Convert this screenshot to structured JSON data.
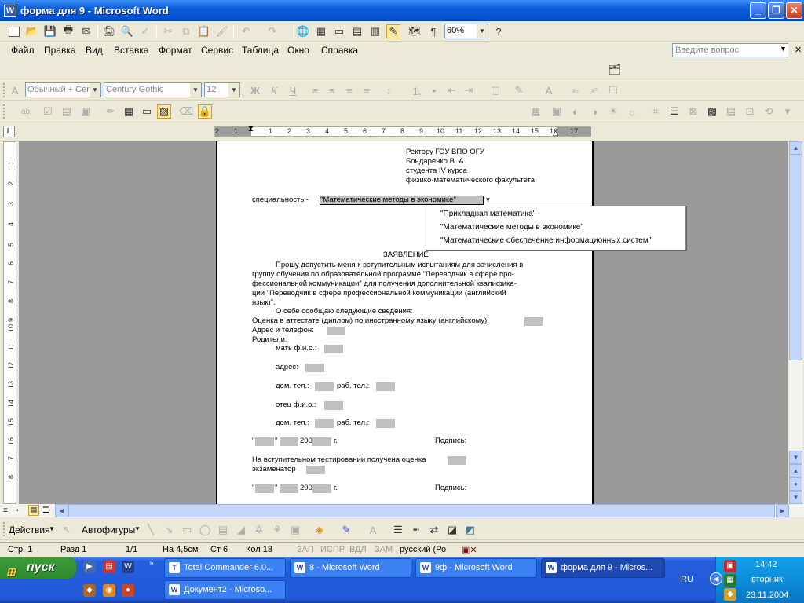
{
  "window": {
    "title": "форма для 9 - Microsoft Word",
    "app_icon": "word-icon"
  },
  "menu": [
    "Файл",
    "Правка",
    "Вид",
    "Вставка",
    "Формат",
    "Сервис",
    "Таблица",
    "Окно",
    "Справка"
  ],
  "help_box_placeholder": "Введите вопрос",
  "toolbar": {
    "zoom": "60%",
    "style": "Обычный + Cen",
    "font": "Century Gothic",
    "size": "12"
  },
  "ruler": {
    "numbers": [
      "2",
      "1",
      "1",
      "2",
      "3",
      "4",
      "5",
      "6",
      "7",
      "8",
      "9",
      "10",
      "11",
      "12",
      "13",
      "14",
      "15",
      "16",
      "17",
      "18"
    ],
    "vnumbers": [
      "1",
      "2",
      "3",
      "4",
      "5",
      "6",
      "7",
      "8",
      "9",
      "10",
      "11",
      "12",
      "13",
      "14",
      "15",
      "16",
      "17",
      "18"
    ]
  },
  "document": {
    "header_lines": [
      "Ректору ГОУ ВПО ОГУ",
      "Бондаренко В. А.",
      "студента IV курса",
      "физико-математического факультета"
    ],
    "specialty_label": "специальность -",
    "specialty_value": "\"Математические методы в экономике\"",
    "dropdown_options": [
      "\"Прикладная математика\"",
      "\"Математические методы в экономике\"",
      "\"Математические обеспечение информационных систем\""
    ],
    "statement_title": "ЗАЯВЛЕНИЕ",
    "body_lines": [
      "Прошу допустить меня к вступительным испытаниям для зачисления в",
      "группу обучения по образовательной программе \"Переводчик в сфере про-",
      "фессиональной коммуникации\" для получения дополнительной квалифика-",
      "ции \"Переводчик в сфере профессиональной коммуникации (английский",
      "язык)\"."
    ],
    "about_line": "О себе сообщаю следующие сведения:",
    "grade_line": "Оценка в аттестате (диплом) по иностранному языку (английскому):",
    "address_phone": "Адрес и телефон:",
    "parents": "Родители:",
    "mother": "мать ф.и.о.:",
    "address": "адрес:",
    "home_phone": "дом. тел.:",
    "work_phone": "раб. тел.:",
    "father": "отец ф.и.о.:",
    "quote": "\"",
    "year": "200",
    "year_suffix": "г.",
    "signature": "Подпись:",
    "test_line": "На вступительном тестировании получена оценка",
    "examiner": "экзаменатор"
  },
  "drawbar": {
    "actions": "Действия",
    "autoshapes": "Автофигуры"
  },
  "status": {
    "page": "Стр. 1",
    "section": "Разд 1",
    "pages": "1/1",
    "at": "На 4,5см",
    "line": "Ст 6",
    "col": "Кол 18",
    "rec": "ЗАП",
    "trk": "ИСПР",
    "ext": "ВДЛ",
    "ovr": "ЗАМ",
    "lang": "русский (Ро"
  },
  "taskbar": {
    "start": "пуск",
    "tasks": [
      "Total Commander 6.0...",
      "8 - Microsoft Word",
      "9ф - Microsoft Word",
      "форма для 9 - Micros...",
      "Документ2 - Microso..."
    ],
    "lang": "RU",
    "time": "14:42",
    "day": "вторник",
    "date": "23.11.2004"
  },
  "colors": {
    "titlebar": "#0a5fdc",
    "taskbar": "#245edc",
    "start": "#3c9c3c",
    "tray": "#0c8ad5"
  }
}
